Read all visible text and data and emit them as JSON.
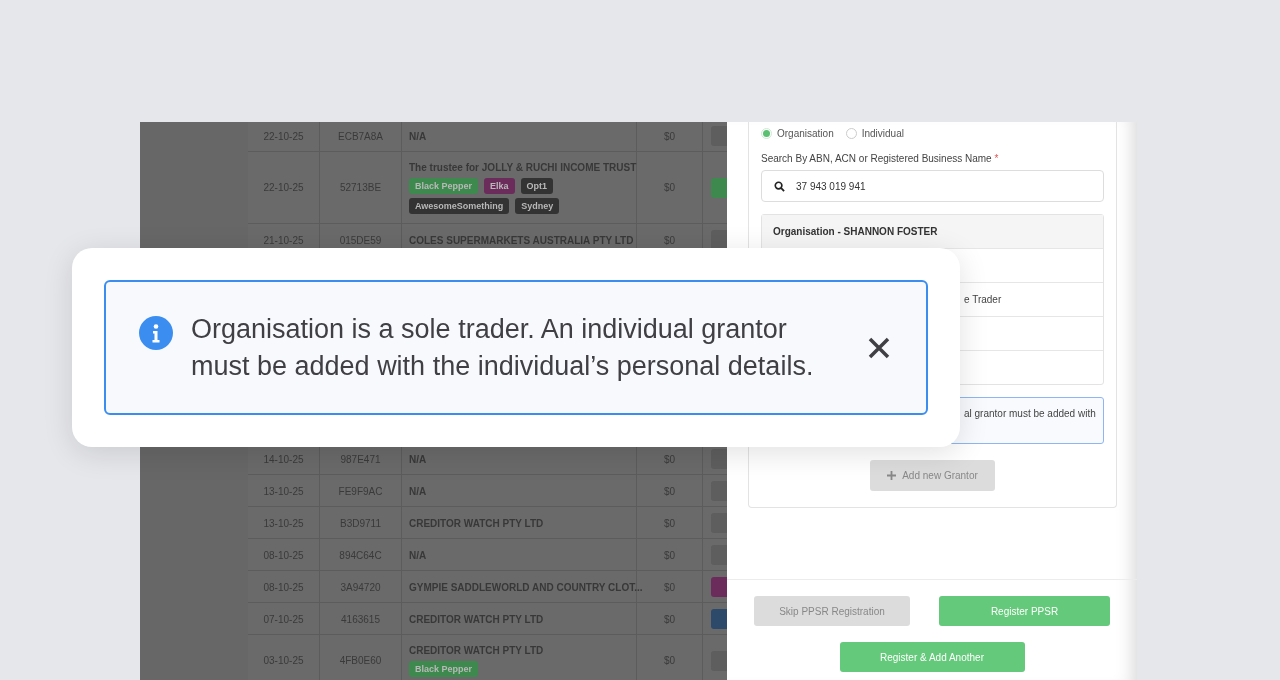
{
  "table": {
    "rows": [
      {
        "date": "22-10-25",
        "ref": "ECB7A8A",
        "name": "N/A",
        "amount": "$0",
        "action": {
          "color": "#5e5e5e"
        }
      },
      {
        "date": "22-10-25",
        "ref": "52713BE",
        "name": "The trustee for JOLLY & RUCHI INCOME TRUST",
        "tags": [
          {
            "label": "Black Pepper",
            "color": "#3e8a4e"
          },
          {
            "label": "Elka",
            "color": "#6b2c5c"
          },
          {
            "label": "Opt1",
            "color": "#333333"
          },
          {
            "label": "AwesomeSomething",
            "color": "#333333"
          },
          {
            "label": "Sydney",
            "color": "#333333"
          }
        ],
        "amount": "$0",
        "action": {
          "color": "#3e8a4e"
        }
      },
      {
        "date": "21-10-25",
        "ref": "015DE59",
        "name": "COLES SUPERMARKETS AUSTRALIA PTY LTD",
        "amount": "$0",
        "action": {
          "color": "#5e5e5e"
        }
      }
    ],
    "rows_below_card": [
      {
        "date": "14-10-25",
        "ref": "987E471",
        "name": "N/A",
        "amount": "$0",
        "action": {
          "color": "#5e5e5e"
        }
      },
      {
        "date": "13-10-25",
        "ref": "FE9F9AC",
        "name": "N/A",
        "amount": "$0",
        "action": {
          "color": "#5e5e5e"
        }
      },
      {
        "date": "13-10-25",
        "ref": "B3D9711",
        "name": "CREDITOR WATCH PTY LTD",
        "amount": "$0",
        "action": {
          "color": "#5e5e5e"
        }
      },
      {
        "date": "08-10-25",
        "ref": "894C64C",
        "name": "N/A",
        "amount": "$0",
        "action": {
          "color": "#5e5e5e"
        }
      },
      {
        "date": "08-10-25",
        "ref": "3A94720",
        "name": "GYMPIE SADDLEWORLD AND COUNTRY CLOT...",
        "amount": "$0",
        "action": {
          "color": "#6b2c5c"
        }
      },
      {
        "date": "07-10-25",
        "ref": "4163615",
        "name": "CREDITOR WATCH PTY LTD",
        "amount": "$0",
        "action": {
          "color": "#2d4a6a"
        }
      },
      {
        "date": "03-10-25",
        "ref": "4FB0E60",
        "name": "CREDITOR WATCH PTY LTD",
        "tags": [
          {
            "label": "Black Pepper",
            "color": "#3e8a4e"
          }
        ],
        "amount": "$0",
        "action": {
          "color": "#5e5e5e"
        }
      }
    ]
  },
  "panel": {
    "radios": [
      {
        "label": "Organisation",
        "selected": true
      },
      {
        "label": "Individual",
        "selected": false
      }
    ],
    "search_label": "Search By ABN, ACN or Registered Business Name",
    "required_mark": "*",
    "search_value": "37 943 019 941",
    "result_header": "Organisation - SHANNON FOSTER",
    "result_rows": [
      {},
      {
        "text": "e Trader"
      },
      {},
      {}
    ],
    "alert_text": "al grantor must be added with",
    "add_button": {
      "label": "Add new Grantor",
      "disabled": true
    },
    "footer_buttons": [
      {
        "label": "Skip PPSR Registration",
        "kind": "secondary"
      },
      {
        "label": "Register PPSR",
        "kind": "primary"
      },
      {
        "label": "Register & Add Another",
        "kind": "primary"
      }
    ]
  },
  "callout": {
    "message": "Organisation is a sole trader. An individual grantor must be added with the individual’s personal details."
  }
}
